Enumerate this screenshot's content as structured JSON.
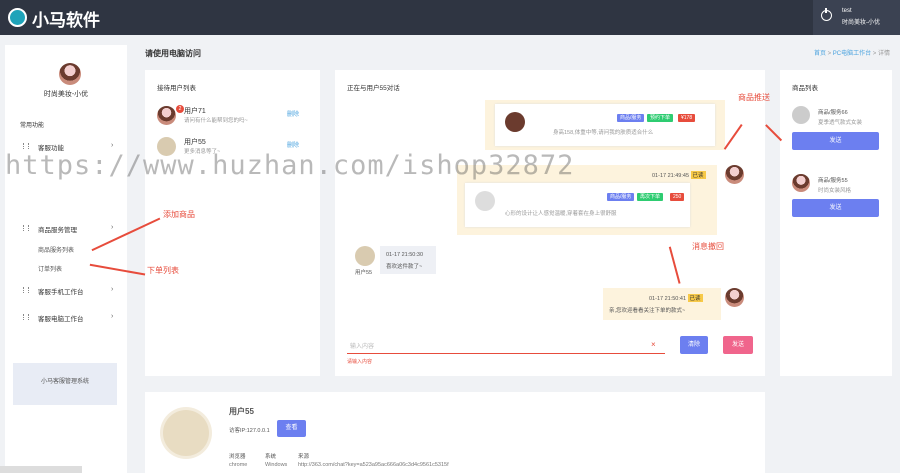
{
  "header": {
    "brand": "小马软件",
    "user_name": "test",
    "user_role": "时尚美妆-小优"
  },
  "sidebar": {
    "user_name": "时尚美妆-小优",
    "section": "常用功能",
    "menu": [
      {
        "label": "客服功能",
        "chev": "›"
      },
      {
        "label": "商品服务管理",
        "chev": "›"
      },
      {
        "label": "客服手机工作台",
        "chev": "›"
      },
      {
        "label": "客服电脑工作台",
        "chev": "›"
      }
    ],
    "subs": [
      "商品服务列表",
      "订单列表"
    ],
    "footer": "小马客服管理系统"
  },
  "page": {
    "title": "请使用电脑访问",
    "breadcrumb": [
      "首页",
      "PC电脑工作台",
      "详情"
    ]
  },
  "wait_list": {
    "title": "接待用户列表",
    "users": [
      {
        "name": "用户71",
        "badge": "2",
        "msg": "请问有什么能帮到您的吗~",
        "action": "删除"
      },
      {
        "name": "用户55",
        "msg": "更多消息等了~",
        "action": "删除"
      }
    ]
  },
  "chat": {
    "title": "正在与用户55对话",
    "msg1_text": "身高158,体重中等,请问我的肤质适合什么",
    "msg1_tags": [
      "商品/服务",
      "预约下单",
      "¥178"
    ],
    "msg2_time": "01-17 21:49:45",
    "msg2_hl": "已读",
    "msg2_text": "心形的设计让人感觉温暖,穿着套在身上很舒服",
    "msg2_tags": [
      "商品/服务",
      "再次下单",
      "250"
    ],
    "msg3_time": "01-17 21:50:30",
    "msg3_text": "喜欢这件款了~",
    "msg3_user": "用户55",
    "msg4_time": "01-17 21:50:41",
    "msg4_hl": "已读",
    "msg4_text": "亲,您欢迎看看关注下单的款式~",
    "input_placeholder": "输入内容",
    "warning": "请输入内容",
    "send_label": "发送",
    "clear_label": "清除"
  },
  "goods": {
    "title": "商品列表",
    "items": [
      {
        "name": "商品/服务66",
        "desc": "夏季透气款式女装",
        "btn": "发送"
      },
      {
        "name": "商品/服务55",
        "desc": "时尚女装风格",
        "btn": "发送"
      }
    ]
  },
  "annotations": {
    "add_goods": "添加商品",
    "order_list": "下单列表",
    "goods_push": "商品推送",
    "msg_recall": "消息撤回"
  },
  "watermark": "https://www.huzhan.com/ishop32872",
  "info": {
    "user_name": "用户55",
    "ip_label": "访客IP:127.0.0.1",
    "view_btn": "查看",
    "col_browser": "浏览器",
    "col_system": "系统",
    "col_source": "来源",
    "browser": "chrome",
    "system": "Windows",
    "source": "http://363.com/chat?key=a523a95ac666a06c3d4c9561c5315f"
  },
  "colors": {
    "header": "#2f3542",
    "accent": "#6c7ff0",
    "danger": "#e74c3c",
    "bubble": "#fdf3dd"
  }
}
